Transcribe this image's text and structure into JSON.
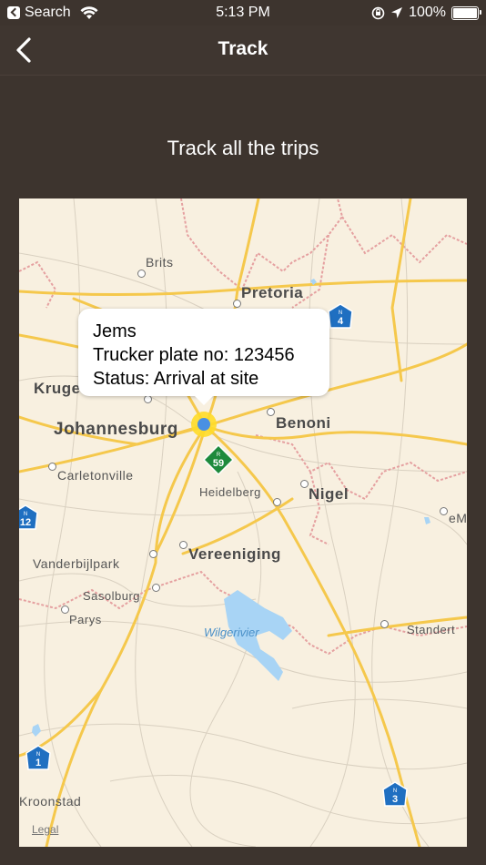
{
  "status_bar": {
    "back_app": "Search",
    "time": "5:13 PM",
    "battery": "100%"
  },
  "nav": {
    "title": "Track"
  },
  "subtitle": "Track all the trips",
  "map": {
    "cities": {
      "brits": "Brits",
      "pretoria": "Pretoria",
      "krugersdorp": "Kruge",
      "johannesburg": "Johannesburg",
      "benoni": "Benoni",
      "carletonville": "Carletonville",
      "heidelberg": "Heidelberg",
      "nigel": "Nigel",
      "emalahleni": "eM",
      "vanderbijlpark": "Vanderbijlpark",
      "vereeniging": "Vereeniging",
      "sasolburg": "Sasolburg",
      "parys": "Parys",
      "standerton": "Standert",
      "kroonstad": "Kroonstad"
    },
    "water": "Wilgerivier",
    "shields": {
      "n4": "4",
      "r59": "59",
      "n12": "12",
      "n1": "1",
      "n3": "3",
      "n_prefix": "N",
      "r_prefix": "R"
    },
    "legal": "Legal",
    "callout": {
      "name": "Jems",
      "plate": "Trucker plate no: 123456",
      "status": "Status: Arrival at site"
    }
  },
  "colors": {
    "background": "#3d342e",
    "map_land": "#f8f0e0",
    "road": "#f5c84c",
    "pin": "#4a90e2",
    "shield_blue": "#1f6fc1",
    "shield_green": "#1e8a3c"
  }
}
